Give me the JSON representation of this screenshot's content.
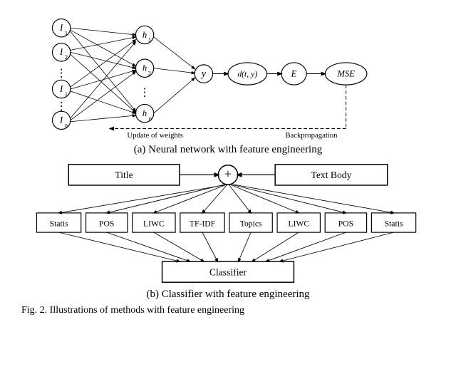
{
  "figure": {
    "part_a": {
      "caption": "(a) Neural network with feature engineering",
      "update_weights_label": "Update of weights",
      "backprop_label": "Backpropagation"
    },
    "part_b": {
      "caption": "(b) Classifier with feature engineering",
      "nodes": {
        "title": "Title",
        "text_body": "Text Body",
        "plus": "+",
        "statis1": "Statis",
        "pos1": "POS",
        "liwc1": "LIWC",
        "tfidf": "TF-IDF",
        "topics": "Topics",
        "liwc2": "LIWC",
        "pos2": "POS",
        "statis2": "Statis",
        "classifier": "Classifier"
      }
    },
    "fig_label": "Fig. 2. Illustrations of methods with feature engineering"
  }
}
